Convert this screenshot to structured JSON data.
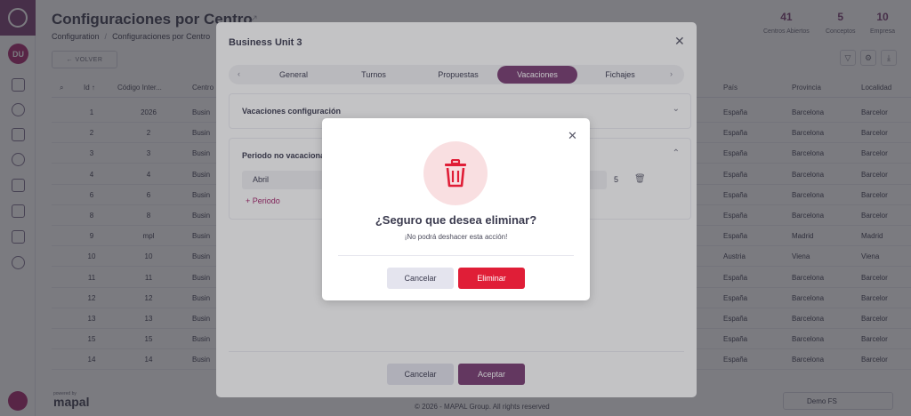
{
  "header": {
    "title": "Configuraciones por Centro",
    "breadcrumb": [
      "Configuration",
      "/",
      "Configuraciones por Centro"
    ],
    "stats": [
      {
        "value": "41",
        "label": "Centros Abiertos"
      },
      {
        "value": "5",
        "label": "Conceptos"
      },
      {
        "value": "10",
        "label": "Empresa"
      }
    ]
  },
  "sidebar": {
    "avatar_initials": "DU",
    "icons": [
      "dashboard-icon",
      "user-circle-icon",
      "calendar-icon",
      "hand-icon",
      "document-icon",
      "archive-icon",
      "calendar-grid-icon",
      "settings-icon"
    ]
  },
  "toolbar": {
    "back_label": "← VOLVER",
    "icons": [
      "filter-icon",
      "settings-icon",
      "download-icon"
    ]
  },
  "table": {
    "columns": [
      "Id ↑",
      "Código Inter...",
      "Centro",
      "País",
      "Provincia",
      "Localidad"
    ],
    "rows": [
      {
        "id": "1",
        "code": "2026",
        "centro": "Busin",
        "pais": "España",
        "provincia": "Barcelona",
        "localidad": "Barcelor"
      },
      {
        "id": "2",
        "code": "2",
        "centro": "Busin",
        "pais": "España",
        "provincia": "Barcelona",
        "localidad": "Barcelor"
      },
      {
        "id": "3",
        "code": "3",
        "centro": "Busin",
        "pais": "España",
        "provincia": "Barcelona",
        "localidad": "Barcelor"
      },
      {
        "id": "4",
        "code": "4",
        "centro": "Busin",
        "pais": "España",
        "provincia": "Barcelona",
        "localidad": "Barcelor"
      },
      {
        "id": "6",
        "code": "6",
        "centro": "Busin",
        "pais": "España",
        "provincia": "Barcelona",
        "localidad": "Barcelor"
      },
      {
        "id": "8",
        "code": "8",
        "centro": "Busin",
        "pais": "España",
        "provincia": "Barcelona",
        "localidad": "Barcelor"
      },
      {
        "id": "9",
        "code": "mpl",
        "centro": "Busin",
        "pais": "España",
        "provincia": "Madrid",
        "localidad": "Madrid"
      },
      {
        "id": "10",
        "code": "10",
        "centro": "Busin",
        "pais": "Austria",
        "provincia": "Viena",
        "localidad": "Viena"
      },
      {
        "id": "11",
        "code": "11",
        "centro": "Busin",
        "pais": "España",
        "provincia": "Barcelona",
        "localidad": "Barcelor"
      },
      {
        "id": "12",
        "code": "12",
        "centro": "Busin",
        "pais": "España",
        "provincia": "Barcelona",
        "localidad": "Barcelor"
      },
      {
        "id": "13",
        "code": "13",
        "centro": "Busin",
        "pais": "España",
        "provincia": "Barcelona",
        "localidad": "Barcelor"
      },
      {
        "id": "15",
        "code": "15",
        "centro": "Busin",
        "pais": "España",
        "provincia": "Barcelona",
        "localidad": "Barcelor"
      },
      {
        "id": "14",
        "code": "14",
        "centro": "Busin",
        "pais": "España",
        "provincia": "Barcelona",
        "localidad": "Barcelor"
      }
    ]
  },
  "footer": {
    "powered_by": "powered by",
    "logo": "mapal",
    "copyright": "© 2026 - MAPAL Group. All rights reserved",
    "company_select": "Demo FS"
  },
  "bu_modal": {
    "title": "Business Unit 3",
    "tabs": [
      "General",
      "Turnos",
      "Propuestas",
      "Vacaciones",
      "Fichajes"
    ],
    "active_tab": "Vacaciones",
    "section1_title": "Vacaciones configuración",
    "section2_title": "Periodo no vacacional",
    "period_month": "Abril",
    "period_value": "5",
    "add_period": "+ Periodo",
    "cancel": "Cancelar",
    "accept": "Aceptar"
  },
  "confirm": {
    "title": "¿Seguro que desea eliminar?",
    "subtitle": "¡No podrá deshacer esta acción!",
    "cancel": "Cancelar",
    "delete": "Eliminar"
  },
  "colors": {
    "brand": "#7a3d74",
    "accent": "#a4246b",
    "danger": "#e01e37",
    "danger_soft": "#f9dfe1"
  }
}
